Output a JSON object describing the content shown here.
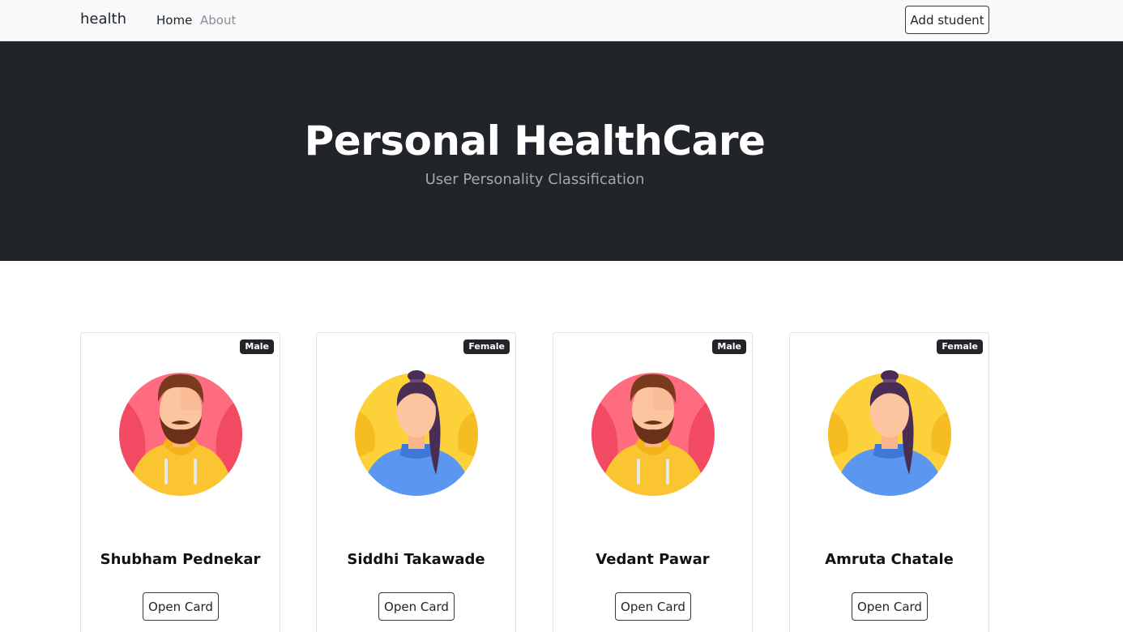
{
  "navbar": {
    "brand": "health",
    "links": [
      {
        "label": "Home"
      },
      {
        "label": "About"
      }
    ],
    "add_button": "Add student"
  },
  "hero": {
    "title": "Personal HealthCare",
    "subtitle": "User Personality Classification"
  },
  "cards": [
    {
      "name": "Shubham Pednekar",
      "gender": "Male",
      "avatar": "male-avatar-icon",
      "button": "Open Card"
    },
    {
      "name": "Siddhi Takawade",
      "gender": "Female",
      "avatar": "female-avatar-icon",
      "button": "Open Card"
    },
    {
      "name": "Vedant Pawar",
      "gender": "Male",
      "avatar": "male-avatar-icon",
      "button": "Open Card"
    },
    {
      "name": "Amruta Chatale",
      "gender": "Female",
      "avatar": "female-avatar-icon",
      "button": "Open Card"
    }
  ],
  "colors": {
    "hero_bg": "#212529",
    "navbar_bg": "#f8f9fa",
    "male_avatar_bg": "#ff6b7f",
    "female_avatar_bg": "#fdd13a"
  }
}
